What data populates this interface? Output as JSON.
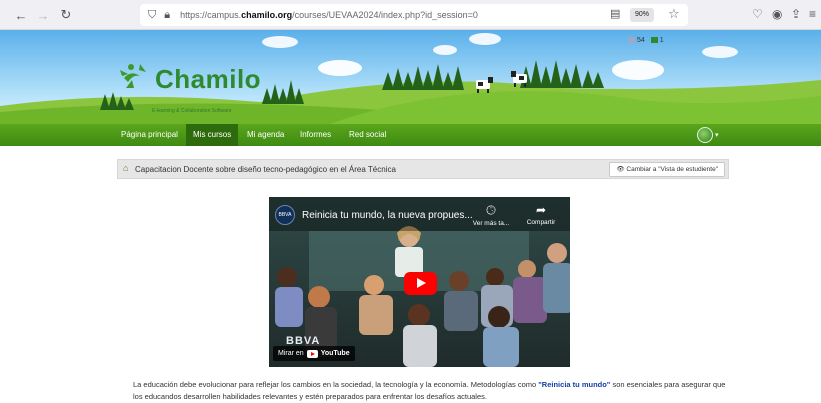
{
  "browser": {
    "url_prefix": "https://campus.",
    "url_domain": "chamilo.org",
    "url_suffix": "/courses/UEVAA2024/index.php?id_session=0",
    "zoom": "90%"
  },
  "header": {
    "logo_text": "Chamilo",
    "logo_sub": "E-learning & Collaboration Software",
    "counter_a": "54",
    "counter_b": "1"
  },
  "menu": {
    "items": [
      "Página principal",
      "Mis cursos",
      "Mi agenda",
      "Informes",
      "Red social"
    ],
    "active_index": 1
  },
  "course": {
    "title": "Capacitacion Docente sobre diseño tecno-pedagógico en el Área Técnica",
    "student_view_button": "Cambiar a \"Vista de estudiente\""
  },
  "video": {
    "title": "Reinicia tu mundo, la nueva propues...",
    "watch_later": "Ver más ta...",
    "share": "Compartir",
    "brand": "BBVA",
    "watch_on": "Mirar en",
    "yt_word": "YouTube"
  },
  "description": {
    "part1": "La educación debe evolucionar para reflejar los cambios en la sociedad, la tecnología y la economía. Metodologías como ",
    "highlight": "\"Reinicia tu mundo\"",
    "part2": " son esenciales para asegurar que los educandos desarrollen habilidades relevantes y estén preparados para enfrentar los desafíos actuales."
  },
  "colors": {
    "menu_green": "#4a981a",
    "menu_active": "#2e6b0c",
    "logo_green": "#2e8a2e",
    "highlight_blue": "#1540a8",
    "youtube_red": "#ff0000"
  }
}
